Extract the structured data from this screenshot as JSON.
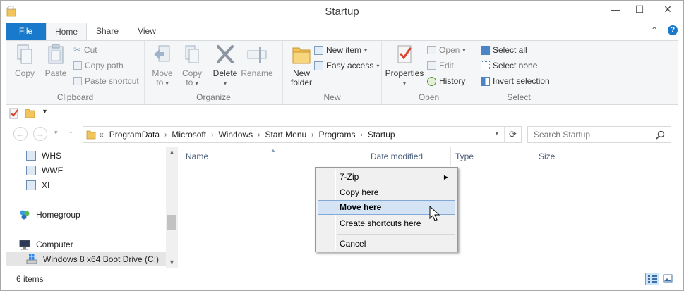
{
  "window": {
    "title": "Startup"
  },
  "titlebar_buttons": {
    "minimize": "—",
    "maximize": "☐",
    "close": "✕"
  },
  "ribbon_tabs": {
    "file": "File",
    "home": "Home",
    "share": "Share",
    "view": "View",
    "minimize_ribbon": "⌃",
    "help": "?"
  },
  "clipboard": {
    "group_label": "Clipboard",
    "copy": "Copy",
    "paste": "Paste",
    "cut": "Cut",
    "copy_path": "Copy path",
    "paste_shortcut": "Paste shortcut"
  },
  "organize": {
    "group_label": "Organize",
    "move_to_line1": "Move",
    "move_to_line2": "to",
    "copy_to_line1": "Copy",
    "copy_to_line2": "to",
    "delete": "Delete",
    "rename": "Rename"
  },
  "new": {
    "group_label": "New",
    "new_folder_line1": "New",
    "new_folder_line2": "folder",
    "new_item": "New item",
    "easy_access": "Easy access"
  },
  "open": {
    "group_label": "Open",
    "properties": "Properties",
    "open": "Open",
    "edit": "Edit",
    "history": "History"
  },
  "select": {
    "group_label": "Select",
    "select_all": "Select all",
    "select_none": "Select none",
    "invert_selection": "Invert selection"
  },
  "address": {
    "overflow": "«",
    "path": [
      "ProgramData",
      "Microsoft",
      "Windows",
      "Start Menu",
      "Programs",
      "Startup"
    ],
    "search_placeholder": "Search Startup"
  },
  "nav_buttons": {
    "back": "←",
    "forward": "→",
    "up": "↑",
    "history_dropdown": "▾",
    "refresh": "⟳",
    "address_dropdown": "▾"
  },
  "nav_pane": {
    "items": [
      {
        "label": "WHS"
      },
      {
        "label": "WWE"
      },
      {
        "label": "XI"
      },
      {
        "label": "Homegroup"
      },
      {
        "label": "Computer"
      },
      {
        "label": "Windows 8 x64 Boot Drive (C:)"
      }
    ]
  },
  "columns": [
    "Name",
    "Date modified",
    "Type",
    "Size"
  ],
  "context_menu": {
    "items": [
      "7-Zip",
      "Copy here",
      "Move here",
      "Create shortcuts here",
      "Cancel"
    ],
    "highlighted": "Move here"
  },
  "status": {
    "item_count": "6 items"
  },
  "colors": {
    "file_tab": "#1979ca",
    "menu_highlight": "#d4e4f5",
    "folder": "#f2c55c"
  }
}
